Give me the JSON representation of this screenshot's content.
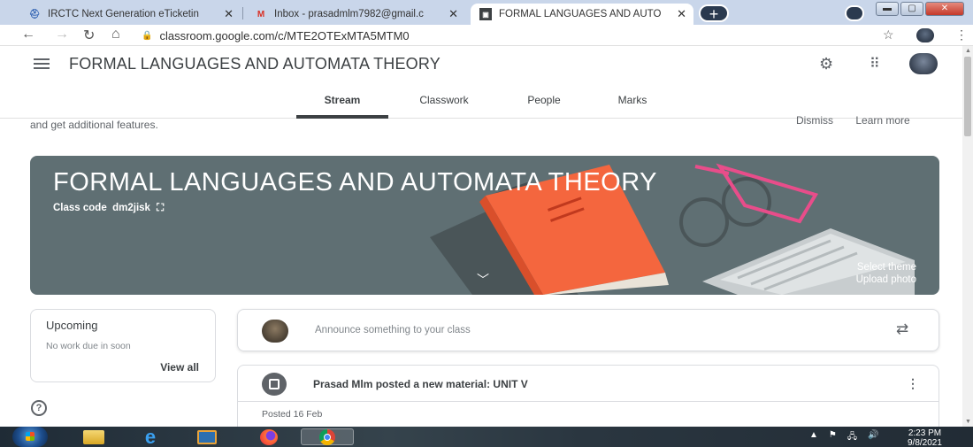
{
  "browser": {
    "tabs": [
      {
        "title": "IRCTC Next Generation eTicketin",
        "icon": "irctc-icon"
      },
      {
        "title": "Inbox - prasadmlm7982@gmail.c",
        "icon": "gmail-icon"
      },
      {
        "title": "FORMAL LANGUAGES AND AUTO",
        "icon": "classroom-icon",
        "active": true
      }
    ],
    "url": "classroom.google.com/c/MTE2OTExMTA5MTM0"
  },
  "header": {
    "class_title": "FORMAL LANGUAGES AND AUTOMATA THEORY",
    "tabs": [
      "Stream",
      "Classwork",
      "People",
      "Marks"
    ],
    "active_tab": "Stream"
  },
  "notice": {
    "text": "and get additional features.",
    "dismiss": "Dismiss",
    "learn_more": "Learn more"
  },
  "banner": {
    "title": "FORMAL LANGUAGES AND AUTOMATA THEORY",
    "class_code_label": "Class code",
    "class_code": "dm2jisk",
    "select_theme": "Select theme",
    "upload_photo": "Upload photo",
    "background_color": "#5f6f73"
  },
  "upcoming": {
    "title": "Upcoming",
    "subtitle": "No work due in soon",
    "view_all": "View all"
  },
  "announce": {
    "placeholder": "Announce something to your class"
  },
  "post": {
    "title": "Prasad Mlm posted a new material: UNIT V",
    "date": "Posted 16 Feb"
  },
  "taskbar": {
    "time": "2:23 PM",
    "date": "9/8/2021"
  }
}
